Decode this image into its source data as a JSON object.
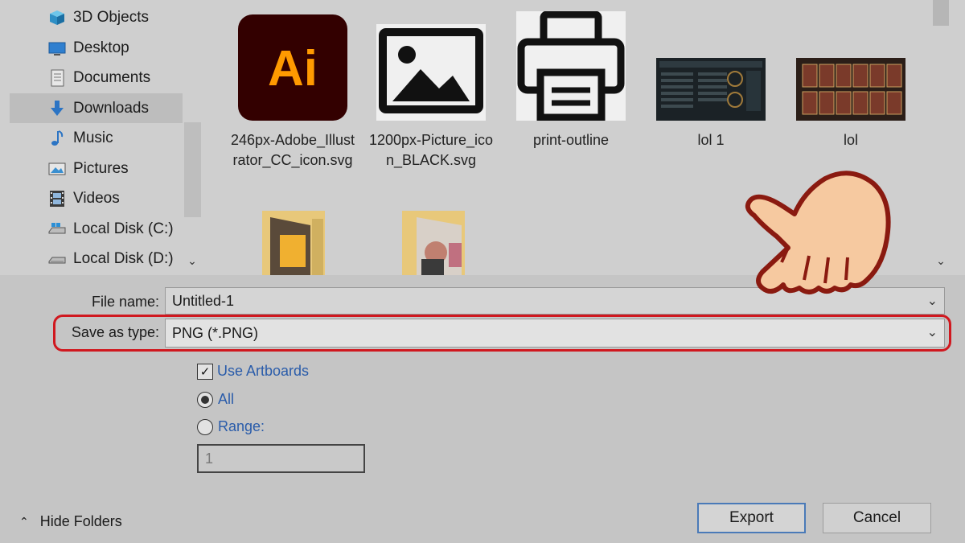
{
  "nav": {
    "items": [
      {
        "label": "3D Objects",
        "icon": "cube-icon"
      },
      {
        "label": "Desktop",
        "icon": "desktop-icon"
      },
      {
        "label": "Documents",
        "icon": "documents-icon"
      },
      {
        "label": "Downloads",
        "icon": "download-arrow-icon",
        "selected": true
      },
      {
        "label": "Music",
        "icon": "music-note-icon"
      },
      {
        "label": "Pictures",
        "icon": "pictures-icon"
      },
      {
        "label": "Videos",
        "icon": "film-icon"
      },
      {
        "label": "Local Disk (C:)",
        "icon": "disk-icon"
      },
      {
        "label": "Local Disk (D:)",
        "icon": "disk-icon"
      }
    ]
  },
  "files": [
    {
      "label": "246px-Adobe_Illustrator_CC_icon.svg",
      "icon": "adobe-illustrator-icon",
      "icon_text": "Ai"
    },
    {
      "label": "1200px-Picture_icon_BLACK.svg",
      "icon": "picture-icon"
    },
    {
      "label": "print-outline",
      "icon": "printer-icon"
    },
    {
      "label": "lol 1",
      "icon": "screenshot-thumbnail"
    },
    {
      "label": "lol",
      "icon": "screenshot-thumbnail"
    },
    {
      "label": "",
      "icon": "folder-icon"
    },
    {
      "label": "",
      "icon": "folder-icon"
    }
  ],
  "form": {
    "file_name_label": "File name:",
    "file_name_value": "Untitled-1",
    "save_type_label": "Save as type:",
    "save_type_value": "PNG (*.PNG)",
    "use_artboards_label": "Use Artboards",
    "use_artboards_checked": true,
    "all_label": "All",
    "range_label": "Range:",
    "range_value": "1"
  },
  "footer": {
    "hide_folders_label": "Hide Folders",
    "export_label": "Export",
    "cancel_label": "Cancel"
  },
  "colors": {
    "highlight": "#d0181f",
    "ai_bg": "#330000",
    "ai_text": "#ff9a00",
    "link": "#2a5caa",
    "hand_skin": "#f6c9a0",
    "hand_outline": "#8a1a10"
  }
}
